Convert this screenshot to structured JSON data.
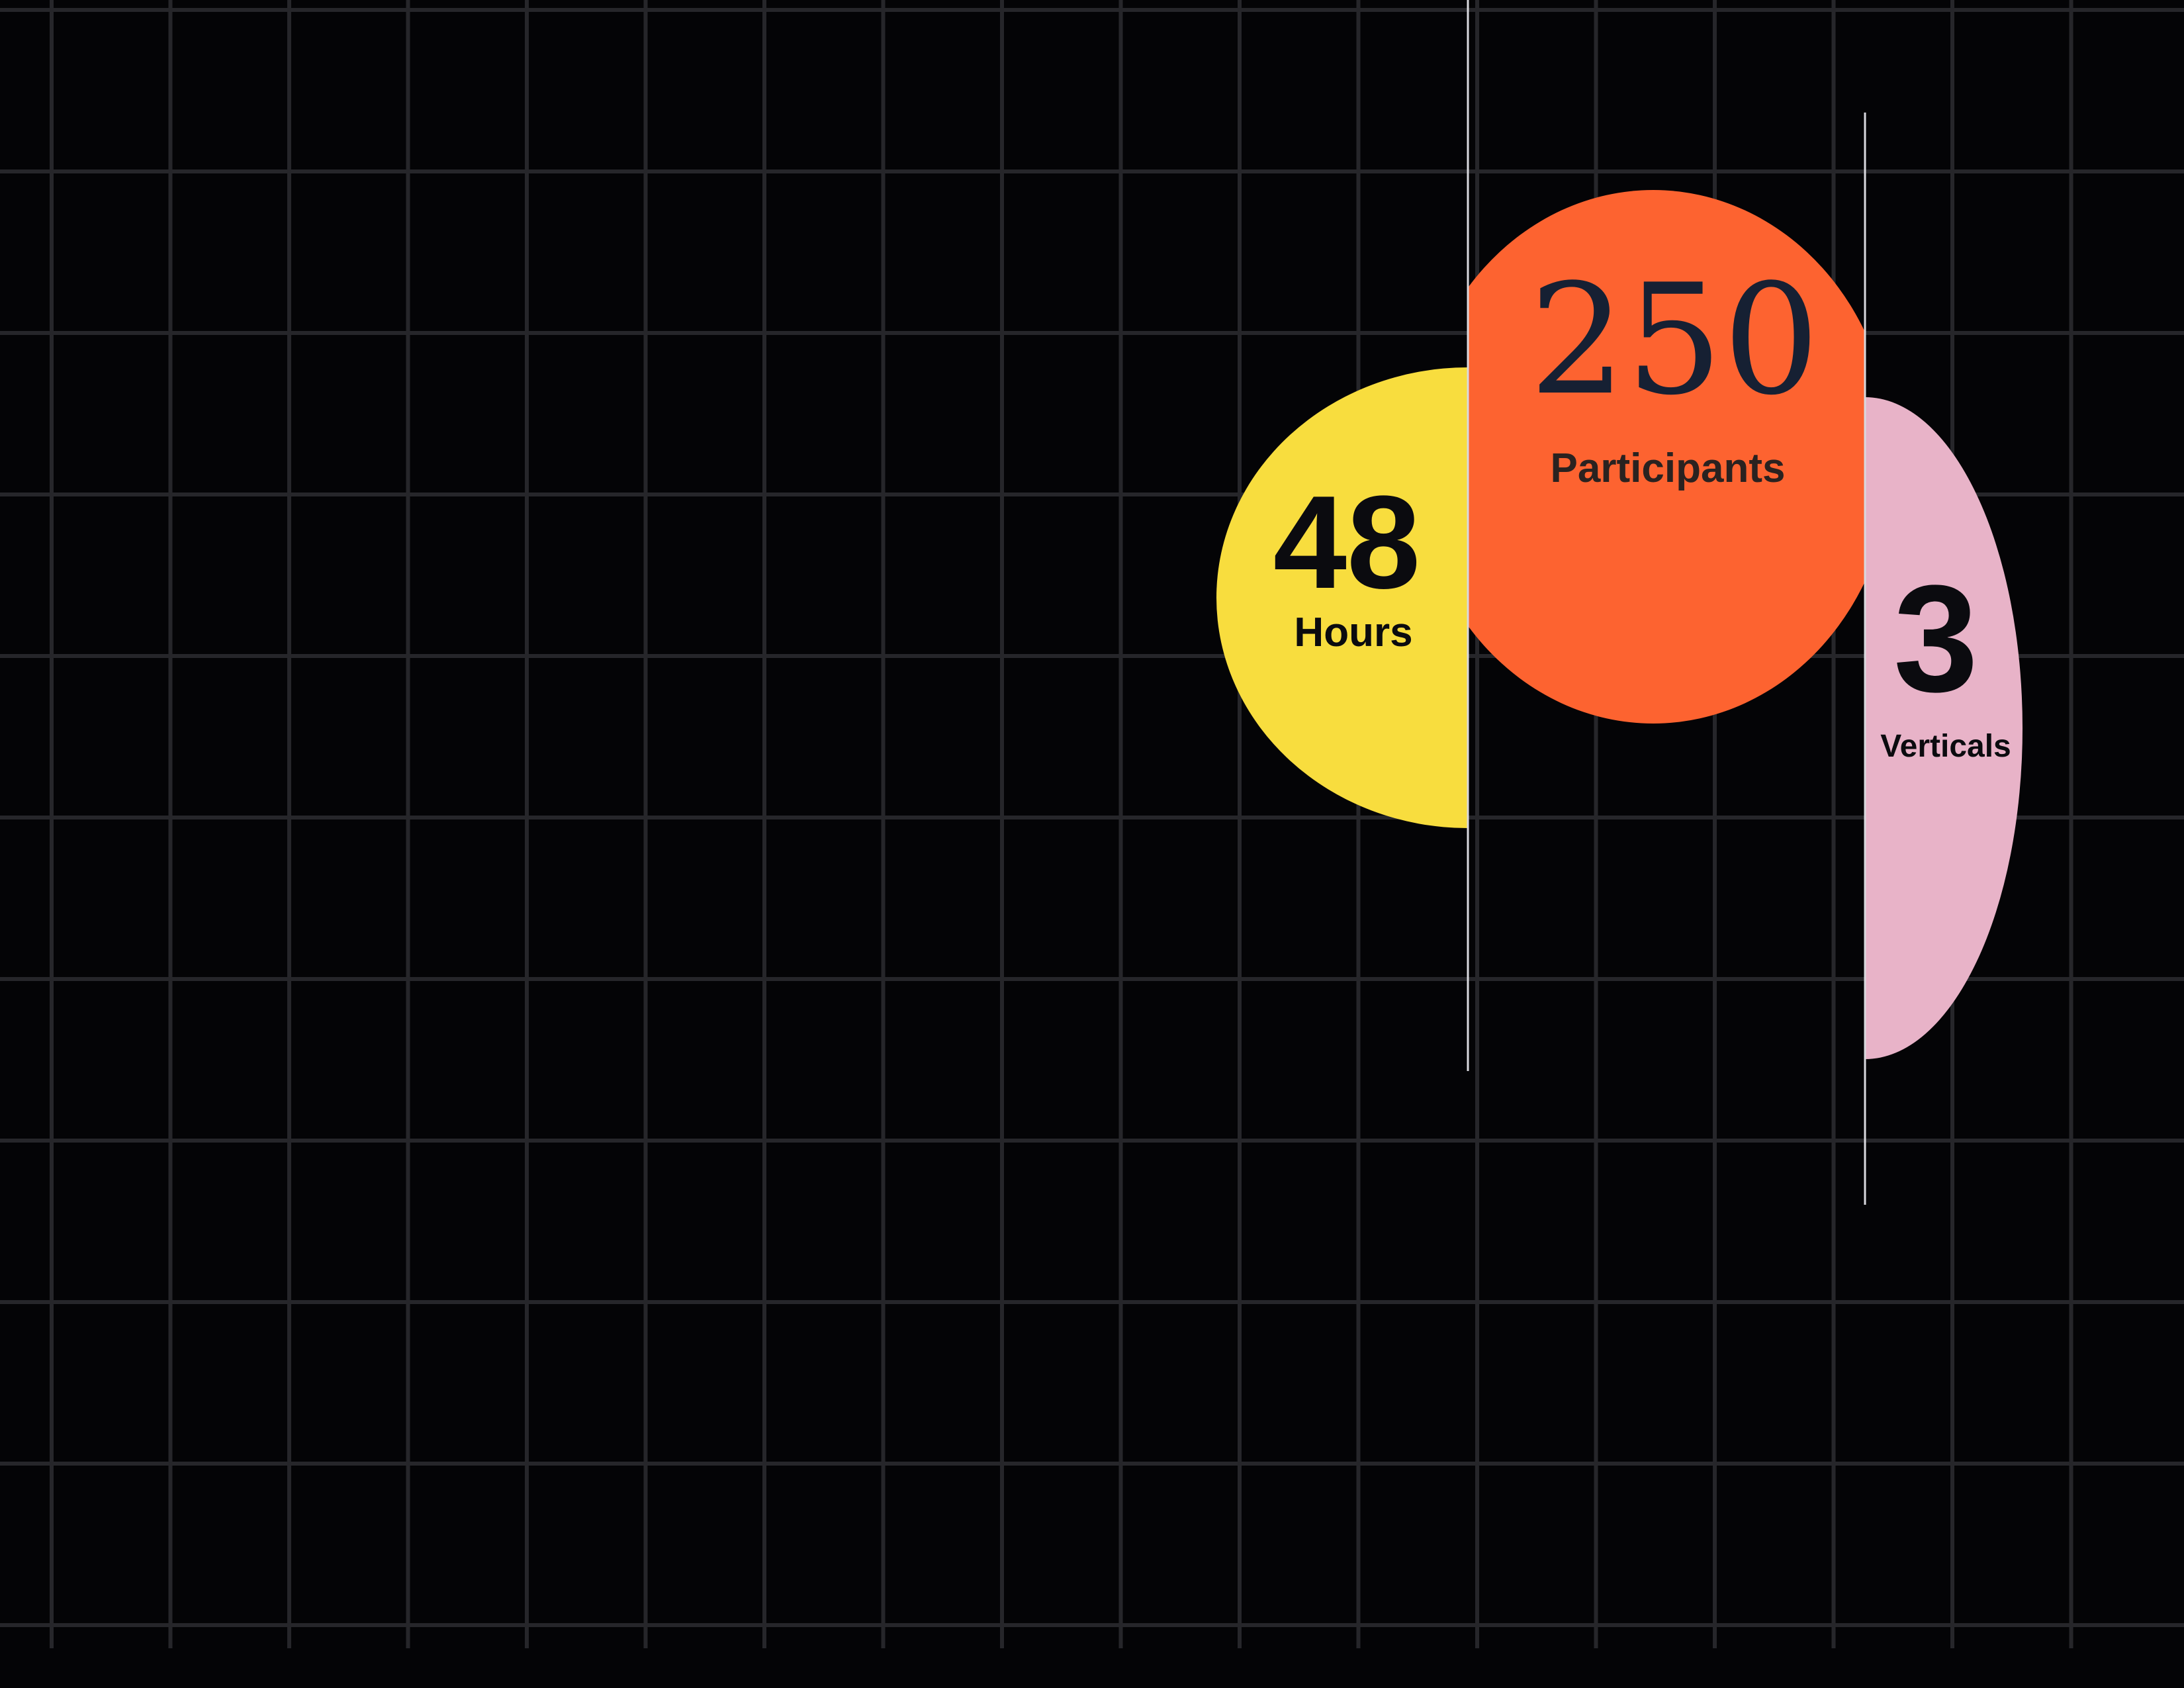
{
  "colors": {
    "background": "#040406",
    "grid_line": "#26262a",
    "hours_circle": "#f8dd3e",
    "participants_circle": "#fd6330",
    "verticals_circle": "#e8b3c8",
    "divider_line": "#d9d9de",
    "dark_text": "#0b0b0f",
    "navy_text": "#162033"
  },
  "stats": {
    "hours": {
      "number": "48",
      "label": "Hours"
    },
    "participants": {
      "number": "250",
      "label": "Participants"
    },
    "verticals": {
      "number": "3",
      "label": "Verticals"
    }
  }
}
